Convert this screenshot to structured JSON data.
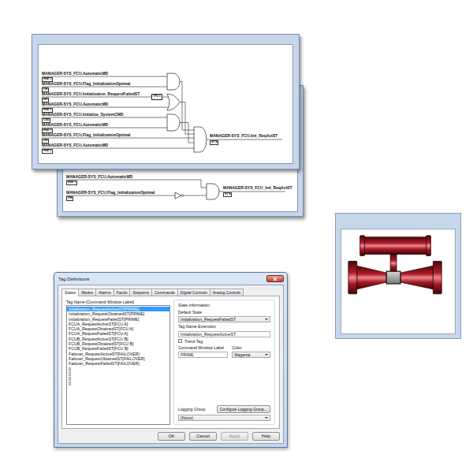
{
  "back_diagram": {
    "inputs": [
      {
        "label": "MANAGER-SYS_FCU.AutomaticMD",
        "tag": "HSE 1"
      },
      {
        "label": "MANAGER-SYS_FCU.Flag_InitializationOptimal",
        "tag": "ON"
      }
    ],
    "output": {
      "label": "MANAGER-SYS_FCU_Init_ReqActST",
      "tag": "ST 4"
    }
  },
  "front_diagram": {
    "inputs": [
      {
        "label": "MANAGER-SYS_FCU.AutomaticMD",
        "tag": "HSE 1"
      },
      {
        "label": "MANAGER-SYS_FCU.Flag_InitializationOptimal",
        "tag": "ON"
      },
      {
        "label": "MANAGER-SYS_FCU.Initialization_RequestFailedST",
        "tag": "Init"
      },
      {
        "label": "MANAGER-SYS_FCU.AutomaticMD",
        "tag": "HSE 1"
      },
      {
        "label": "MANAGER-SYS_FCU.Initialize_SystemCMD",
        "tag": "CSD"
      },
      {
        "label": "MANAGER-SYS_FCU.AutomaticMD",
        "tag": "HSE 1"
      },
      {
        "label": "MANAGER-SYS_FCU.Flag_InitializationOptimal",
        "tag": "ON"
      },
      {
        "label": "MANAGER-SYS_FCU.AutomaticMD",
        "tag": "HSE 1"
      }
    ],
    "timer": "TP0 5",
    "output": {
      "label": "MANAGER-SYS_FCU.Init_ReqActST",
      "tag": "ST 4"
    }
  },
  "dialog": {
    "title": "Tag Definitions",
    "tabs": [
      {
        "label": "States",
        "selected": true
      },
      {
        "label": "Modes",
        "selected": false
      },
      {
        "label": "Alarms",
        "selected": false
      },
      {
        "label": "Faults",
        "selected": false
      },
      {
        "label": "Setpoints",
        "selected": false
      },
      {
        "label": "Commands",
        "selected": false
      },
      {
        "label": "Digital Controls",
        "selected": false
      },
      {
        "label": "Analog Controls",
        "selected": false
      }
    ],
    "list": {
      "header": "Tag Name [Command Window Label]",
      "items": [
        {
          "text": "Initialization_RequestActiveST[PRIME]",
          "selected": true
        },
        {
          "text": "Initialization_RequestObtainedST[PRIME]",
          "selected": false
        },
        {
          "text": "Initialization_RequestFailedST[PRIME]",
          "selected": false
        },
        {
          "text": "FCUA_RequestActiveST[FCU A]",
          "selected": false
        },
        {
          "text": "FCUA_RequestObtainedST[FCU A]",
          "selected": false
        },
        {
          "text": "FCUA_RequestFailedST[FCU A]",
          "selected": false
        },
        {
          "text": "FCUB_RequestActiveST[FCU B]",
          "selected": false
        },
        {
          "text": "FCUB_RequestObtainedST[FCU B]",
          "selected": false
        },
        {
          "text": "FCUB_RequestFailedST[FCU B]",
          "selected": false
        },
        {
          "text": "Failover_RequestActiveST[FAILOVER]",
          "selected": false
        },
        {
          "text": "Failover_RequestObtainedST[FAILOVER]",
          "selected": false
        },
        {
          "text": "Failover_RequestFailedST[FAILOVER]",
          "selected": false
        },
        {
          "text": "[]",
          "selected": false
        },
        {
          "text": "[]",
          "selected": false
        },
        {
          "text": "[]",
          "selected": false
        },
        {
          "text": "[]",
          "selected": false
        }
      ]
    },
    "state_info": {
      "title": "State Information:",
      "default_state": {
        "label": "Default State",
        "value": "Initialization_RequestFailedST"
      },
      "tag_name_extension": {
        "label": "Tag Name Extension",
        "value": "Initialization_RequestActiveST"
      },
      "trend_tag": {
        "label": "Trend Tag",
        "checked": false
      },
      "command_window_label": {
        "label": "Command Window Label",
        "value": "PRIME"
      },
      "color": {
        "label": "Color",
        "value": "Magenta"
      },
      "logging_group": {
        "label": "Logging Group",
        "button": "Configure Logging Group...",
        "value": "(None)"
      }
    },
    "buttons": [
      {
        "label": "OK",
        "disabled": false
      },
      {
        "label": "Cancel",
        "disabled": false
      },
      {
        "label": "Apply",
        "disabled": true
      },
      {
        "label": "Help",
        "disabled": false
      }
    ]
  }
}
